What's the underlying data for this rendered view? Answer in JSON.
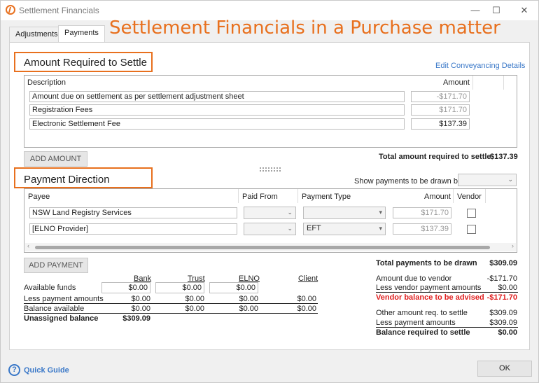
{
  "window": {
    "title": "Settlement Financials",
    "controls": {
      "minimize": "—",
      "maximize": "☐",
      "close": "✕"
    }
  },
  "overlay_title": "Settlement Financials in a Purchase matter",
  "tabs": [
    {
      "label": "Adjustments",
      "active": false
    },
    {
      "label": "Payments",
      "active": true
    }
  ],
  "amount_section": {
    "title": "Amount Required to Settle",
    "edit_link": "Edit Conveyancing Details",
    "columns": {
      "description": "Description",
      "amount": "Amount"
    },
    "rows": [
      {
        "description": "Amount due on settlement as per settlement adjustment sheet",
        "amount": "-$171.70",
        "editable": false
      },
      {
        "description": "Registration Fees",
        "amount": "$171.70",
        "editable": false
      },
      {
        "description": "Electronic Settlement Fee",
        "amount": "$137.39",
        "editable": true
      }
    ],
    "add_button": "ADD AMOUNT",
    "total_label": "Total amount required to settle",
    "total_value": "$137.39"
  },
  "payment_section": {
    "title": "Payment Direction",
    "show_payments_label": "Show payments to be drawn by",
    "show_payments_value": "",
    "columns": {
      "payee": "Payee",
      "paid_from": "Paid From",
      "payment_type": "Payment Type",
      "amount": "Amount",
      "vendor": "Vendor"
    },
    "rows": [
      {
        "payee": "NSW Land Registry Services",
        "paid_from": "",
        "payment_type": "",
        "amount": "$171.70",
        "vendor": false
      },
      {
        "payee": "[ELNO Provider]",
        "paid_from": "",
        "payment_type": "EFT",
        "amount": "$137.39",
        "vendor": false
      }
    ],
    "add_button": "ADD PAYMENT"
  },
  "funds": {
    "columns": [
      "Bank",
      "Trust",
      "ELNO",
      "Client"
    ],
    "available_label": "Available funds",
    "available": [
      "$0.00",
      "$0.00",
      "$0.00"
    ],
    "less_label": "Less payment amounts",
    "less": [
      "$0.00",
      "$0.00",
      "$0.00",
      "$0.00"
    ],
    "balance_label": "Balance available",
    "balance": [
      "$0.00",
      "$0.00",
      "$0.00",
      "$0.00"
    ],
    "unassigned_label": "Unassigned balance",
    "unassigned_value": "$309.09"
  },
  "summary": {
    "total_drawn_label": "Total payments to be drawn",
    "total_drawn_value": "$309.09",
    "due_vendor_label": "Amount due to vendor",
    "due_vendor_value": "-$171.70",
    "less_vendor_label": "Less vendor payment amounts",
    "less_vendor_value": "$0.00",
    "vendor_balance_label": "Vendor balance to be advised",
    "vendor_balance_value": "-$171.70",
    "other_label": "Other amount req. to settle",
    "other_value": "$309.09",
    "less_payment_label": "Less payment amounts",
    "less_payment_value": "$309.09",
    "balance_settle_label": "Balance required to settle",
    "balance_settle_value": "$0.00"
  },
  "footer": {
    "quick_guide": "Quick Guide",
    "help_icon": "?",
    "ok": "OK"
  },
  "colors": {
    "accent": "#e8701e",
    "link": "#3a78c8",
    "negative": "#e02020"
  }
}
